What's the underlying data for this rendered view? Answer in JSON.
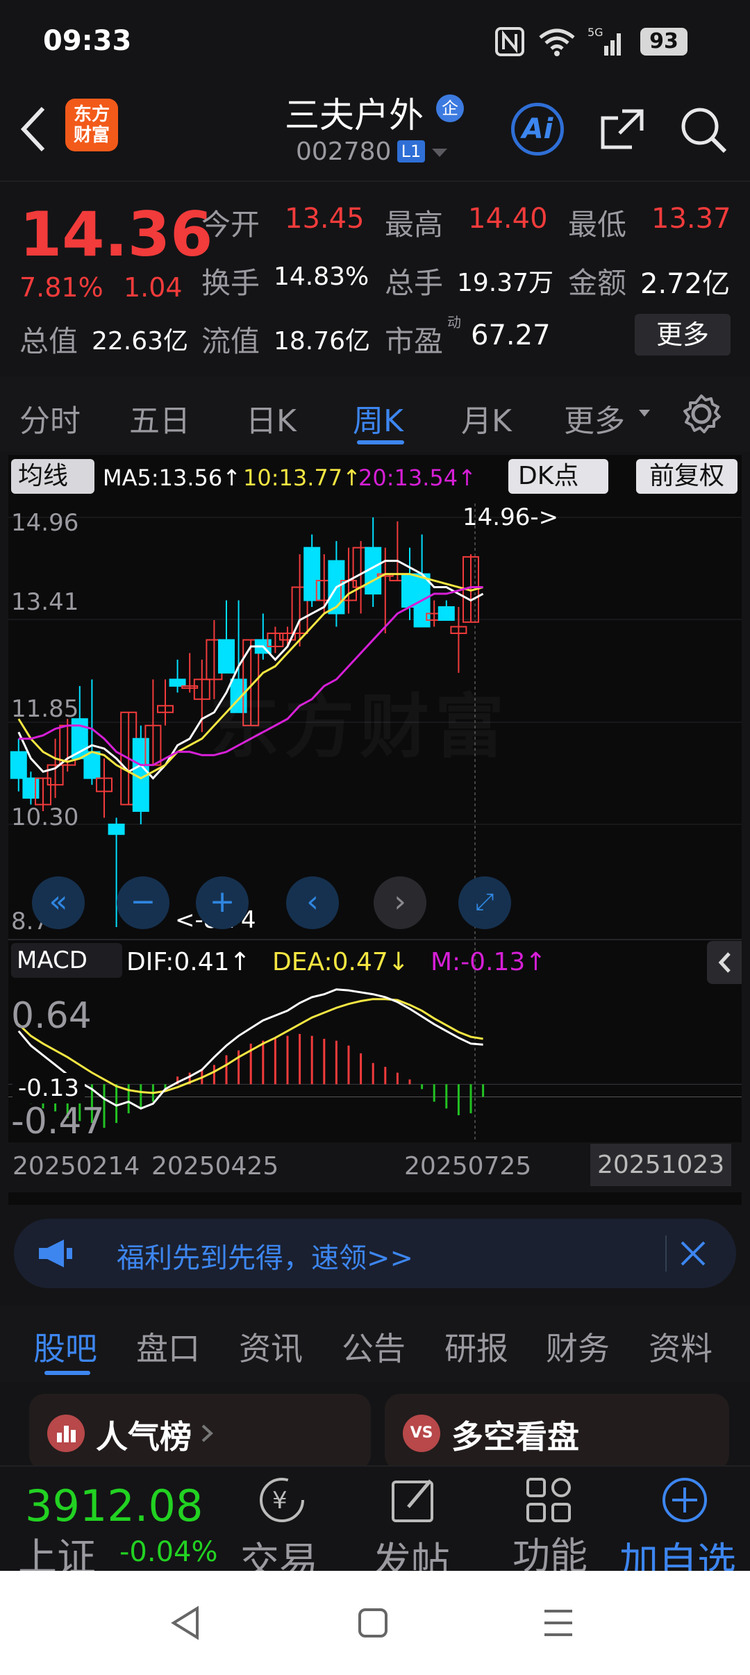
{
  "status": {
    "time": "09:33",
    "battery": "93"
  },
  "header": {
    "back_icon": "chevron-left-icon",
    "logo_line1": "东方",
    "logo_line2": "财富",
    "stock_name": "三夫户外",
    "name_badge": "企",
    "code": "002780",
    "code_badge": "L1",
    "ai_label": "Ai",
    "share_icon": "share-icon",
    "search_icon": "search-icon"
  },
  "quote": {
    "price": "14.36",
    "change_pct": "7.81%",
    "change": "1.04",
    "open_label": "今开",
    "open": "13.45",
    "high_label": "最高",
    "high": "14.40",
    "low_label": "最低",
    "low": "13.37",
    "turnover_label": "换手",
    "turnover": "14.83%",
    "volume_label": "总手",
    "volume": "19.37万",
    "amount_label": "金额",
    "amount": "2.72亿",
    "mktcap_label": "总值",
    "mktcap": "22.63亿",
    "float_label": "流值",
    "float_cap": "18.76亿",
    "pe_label": "市盈",
    "pe_sup": "动",
    "pe": "67.27",
    "more_button": "更多"
  },
  "period_tabs": [
    "分时",
    "五日",
    "日K",
    "周K",
    "月K",
    "更多"
  ],
  "active_period": 3,
  "chart": {
    "ma_select": "均线",
    "ma5": "MA5:13.56",
    "ma10": "10:13.77",
    "ma20": "20:13.54",
    "up_arrow": "↑",
    "down_arrow": "↓",
    "dk_button": "DK点",
    "adjust_button": "前复权",
    "price_ticks": [
      "14.96",
      "13.41",
      "11.85",
      "10.30",
      "8.74"
    ],
    "max_label": "14.96->",
    "min_label": "<-8.74",
    "watermark": "东方财富",
    "macd_select": "MACD",
    "dif": "DIF:0.41",
    "dea": "DEA:0.47",
    "m": "M:-0.13",
    "macd_ticks": [
      "0.64",
      "-0.13",
      "-0.47"
    ],
    "date_ticks": [
      "20250214",
      "20250425",
      "20250725",
      "20251023"
    ],
    "colors": {
      "up": "#f23b3b",
      "down": "#00e0ff",
      "ma5": "#ffffff",
      "ma10": "#f5e642",
      "ma20": "#d61fd6"
    }
  },
  "chart_data": {
    "type": "candlestick",
    "title": "",
    "ylim": [
      8.74,
      14.96
    ],
    "series": [
      {
        "name": "MA5",
        "values": [
          11.7,
          11.3,
          11.1,
          11.15,
          11.3,
          11.4,
          11.5,
          11.45,
          11.3,
          11.1,
          11.2,
          11.0,
          11.2,
          11.5,
          11.6,
          11.9,
          12.0,
          12.3,
          12.7,
          13.0,
          13.0,
          12.8,
          13.0,
          13.4,
          13.5,
          13.6,
          13.9,
          14.0,
          14.1,
          14.2,
          14.3,
          14.3,
          14.2,
          14.1,
          13.9,
          13.9,
          13.8,
          13.7,
          13.8
        ]
      },
      {
        "name": "MA10",
        "values": [
          11.9,
          11.6,
          11.4,
          11.3,
          11.25,
          11.3,
          11.4,
          11.35,
          11.2,
          11.1,
          11.0,
          11.1,
          11.2,
          11.4,
          11.5,
          11.6,
          11.8,
          12.0,
          12.2,
          12.4,
          12.6,
          12.7,
          12.9,
          13.1,
          13.3,
          13.5,
          13.6,
          13.8,
          13.9,
          14.0,
          14.1,
          14.1,
          14.1,
          14.05,
          14.0,
          13.95,
          13.9,
          13.85,
          13.9
        ]
      },
      {
        "name": "MA20",
        "values": [
          11.6,
          11.6,
          11.65,
          11.75,
          11.8,
          11.8,
          11.75,
          11.6,
          11.4,
          11.3,
          11.2,
          11.2,
          11.3,
          11.4,
          11.4,
          11.35,
          11.35,
          11.4,
          11.5,
          11.6,
          11.7,
          11.8,
          11.9,
          12.1,
          12.2,
          12.4,
          12.5,
          12.7,
          12.9,
          13.1,
          13.3,
          13.5,
          13.6,
          13.7,
          13.8,
          13.8,
          13.85,
          13.9,
          13.9
        ]
      }
    ],
    "candles": [
      {
        "o": 11.4,
        "h": 11.6,
        "l": 10.8,
        "c": 11.0
      },
      {
        "o": 11.0,
        "h": 11.1,
        "l": 10.6,
        "c": 10.7
      },
      {
        "o": 10.6,
        "h": 11.0,
        "l": 10.5,
        "c": 11.0
      },
      {
        "o": 10.9,
        "h": 11.6,
        "l": 10.7,
        "c": 11.2
      },
      {
        "o": 11.2,
        "h": 11.9,
        "l": 11.1,
        "c": 11.8
      },
      {
        "o": 11.9,
        "h": 12.4,
        "l": 11.3,
        "c": 11.3
      },
      {
        "o": 11.4,
        "h": 12.5,
        "l": 10.9,
        "c": 11.0
      },
      {
        "o": 10.8,
        "h": 11.3,
        "l": 10.4,
        "c": 11.0
      },
      {
        "o": 10.3,
        "h": 10.4,
        "l": 8.74,
        "c": 10.15
      },
      {
        "o": 10.6,
        "h": 12.0,
        "l": 10.6,
        "c": 12.0
      },
      {
        "o": 11.6,
        "h": 11.8,
        "l": 10.3,
        "c": 10.5
      },
      {
        "o": 11.2,
        "h": 12.5,
        "l": 11.2,
        "c": 11.8
      },
      {
        "o": 12.0,
        "h": 12.5,
        "l": 11.8,
        "c": 12.1
      },
      {
        "o": 12.5,
        "h": 12.8,
        "l": 12.3,
        "c": 12.4
      },
      {
        "o": 12.4,
        "h": 12.9,
        "l": 12.3,
        "c": 12.4
      },
      {
        "o": 12.2,
        "h": 12.8,
        "l": 11.7,
        "c": 12.5
      },
      {
        "o": 12.5,
        "h": 13.4,
        "l": 12.2,
        "c": 13.1
      },
      {
        "o": 13.1,
        "h": 13.7,
        "l": 12.6,
        "c": 12.6
      },
      {
        "o": 12.5,
        "h": 13.7,
        "l": 12.0,
        "c": 12.0
      },
      {
        "o": 11.8,
        "h": 13.1,
        "l": 11.8,
        "c": 13.1
      },
      {
        "o": 13.1,
        "h": 13.5,
        "l": 12.8,
        "c": 12.9
      },
      {
        "o": 13.0,
        "h": 13.3,
        "l": 12.9,
        "c": 13.2
      },
      {
        "o": 13.1,
        "h": 13.3,
        "l": 13.0,
        "c": 13.2
      },
      {
        "o": 13.2,
        "h": 14.4,
        "l": 13.0,
        "c": 13.9
      },
      {
        "o": 14.5,
        "h": 14.7,
        "l": 13.6,
        "c": 13.7
      },
      {
        "o": 13.7,
        "h": 14.4,
        "l": 13.5,
        "c": 14.0
      },
      {
        "o": 14.3,
        "h": 14.6,
        "l": 13.3,
        "c": 13.5
      },
      {
        "o": 13.7,
        "h": 14.5,
        "l": 13.5,
        "c": 14.0
      },
      {
        "o": 13.9,
        "h": 14.6,
        "l": 13.5,
        "c": 14.5
      },
      {
        "o": 14.5,
        "h": 14.96,
        "l": 13.6,
        "c": 13.8
      },
      {
        "o": 14.1,
        "h": 14.5,
        "l": 13.2,
        "c": 14.1
      },
      {
        "o": 14.0,
        "h": 14.9,
        "l": 14.0,
        "c": 14.1
      },
      {
        "o": 14.1,
        "h": 14.5,
        "l": 13.4,
        "c": 13.6
      },
      {
        "o": 14.1,
        "h": 14.7,
        "l": 13.3,
        "c": 13.3
      },
      {
        "o": 13.4,
        "h": 13.7,
        "l": 13.3,
        "c": 13.5
      },
      {
        "o": 13.6,
        "h": 13.7,
        "l": 13.4,
        "c": 13.4
      },
      {
        "o": 13.2,
        "h": 13.6,
        "l": 12.6,
        "c": 13.3
      },
      {
        "o": 13.37,
        "h": 14.4,
        "l": 13.37,
        "c": 14.36
      }
    ],
    "macd": {
      "dif": [
        0.55,
        0.4,
        0.3,
        0.2,
        0.1,
        0.02,
        -0.05,
        -0.15,
        -0.22,
        -0.18,
        -0.25,
        -0.2,
        -0.05,
        0.02,
        0.08,
        0.15,
        0.28,
        0.4,
        0.5,
        0.58,
        0.66,
        0.71,
        0.76,
        0.84,
        0.9,
        0.93,
        0.98,
        0.97,
        0.95,
        0.93,
        0.9,
        0.85,
        0.78,
        0.7,
        0.62,
        0.55,
        0.48,
        0.42,
        0.41
      ],
      "dea": [
        0.62,
        0.5,
        0.42,
        0.35,
        0.28,
        0.2,
        0.12,
        0.05,
        -0.02,
        -0.06,
        -0.08,
        -0.09,
        -0.07,
        -0.03,
        0.02,
        0.07,
        0.13,
        0.2,
        0.28,
        0.35,
        0.42,
        0.48,
        0.55,
        0.62,
        0.69,
        0.74,
        0.79,
        0.83,
        0.86,
        0.88,
        0.88,
        0.87,
        0.82,
        0.76,
        0.68,
        0.61,
        0.54,
        0.49,
        0.47
      ],
      "m": [
        -0.15,
        -0.2,
        -0.25,
        -0.28,
        -0.35,
        -0.38,
        -0.4,
        -0.45,
        -0.4,
        -0.3,
        -0.25,
        -0.18,
        -0.05,
        0.08,
        0.12,
        0.16,
        0.2,
        0.3,
        0.35,
        0.42,
        0.45,
        0.48,
        0.5,
        0.52,
        0.5,
        0.47,
        0.45,
        0.4,
        0.32,
        0.22,
        0.18,
        0.12,
        0.05,
        -0.05,
        -0.18,
        -0.25,
        -0.32,
        -0.3,
        -0.13
      ]
    }
  },
  "banner": {
    "icon": "megaphone-icon",
    "text": "福利先到先得，速领>>",
    "close_icon": "close-icon"
  },
  "content_tabs": [
    "股吧",
    "盘口",
    "资讯",
    "公告",
    "研报",
    "财务",
    "资料"
  ],
  "active_content_tab": 0,
  "cards": {
    "left_title": "人气榜",
    "left_icon": "bar-chart-icon",
    "right_title": "多空看盘",
    "right_icon_text": "VS"
  },
  "bottom": {
    "index_value": "3912.08",
    "index_name": "上证",
    "index_change": "-0.04%",
    "trade": "交易",
    "post": "发帖",
    "func": "功能",
    "add_watch": "加自选"
  },
  "nav": {
    "back": "nav-back-icon",
    "home": "nav-home-icon",
    "menu": "nav-menu-icon"
  }
}
